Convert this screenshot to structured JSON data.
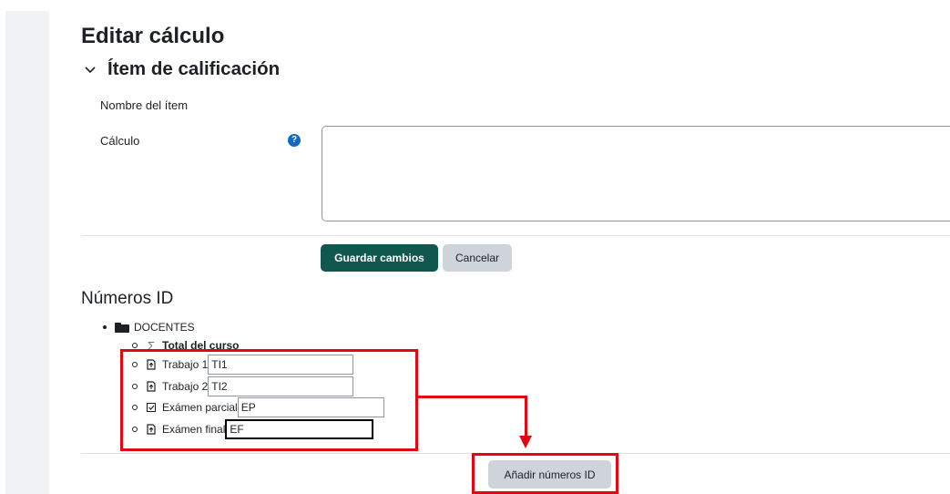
{
  "page": {
    "title": "Editar cálculo",
    "section_title": "Ítem de calificación"
  },
  "form": {
    "item_name_label": "Nombre del ítem",
    "calc_label": "Cálculo",
    "help_icon": "question-circle-icon",
    "calc_value": "",
    "save_label": "Guardar cambios",
    "cancel_label": "Cancelar"
  },
  "ids": {
    "title": "Números ID",
    "root_label": "DOCENTES",
    "root_icon": "folder-icon",
    "items": [
      {
        "icon": "sigma-icon",
        "label": "Total del curso",
        "value": null
      },
      {
        "icon": "assignment-icon",
        "label": "Trabajo 1",
        "value": "TI1"
      },
      {
        "icon": "assignment-icon",
        "label": "Trabajo 2",
        "value": "TI2"
      },
      {
        "icon": "quiz-icon",
        "label": "Exámen parcial",
        "value": "EP"
      },
      {
        "icon": "assignment-icon",
        "label": "Exámen final",
        "value": "EF"
      }
    ],
    "add_label": "Añadir números ID"
  },
  "annotations": {
    "highlight_color": "#e30613"
  }
}
